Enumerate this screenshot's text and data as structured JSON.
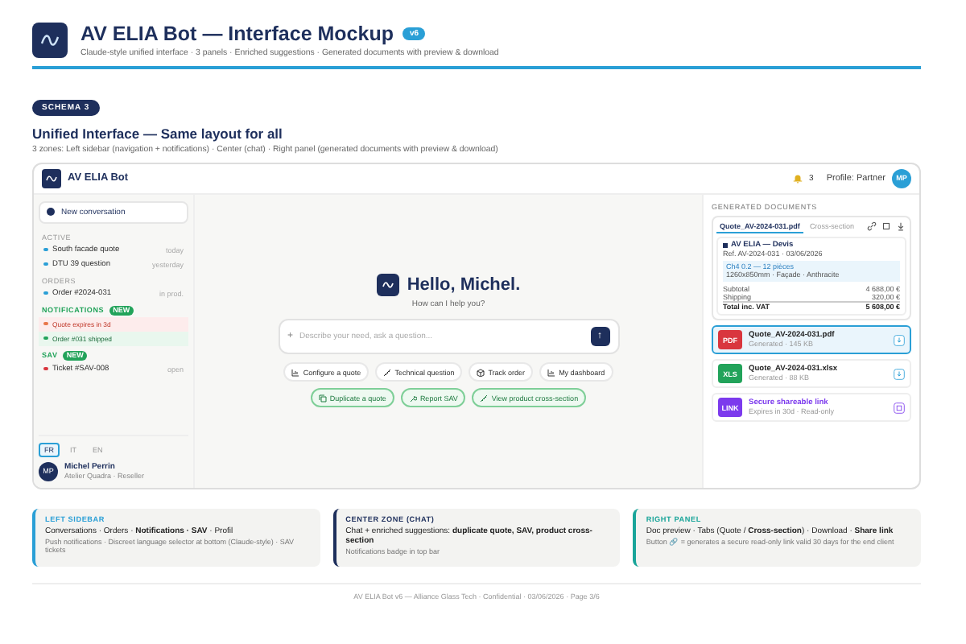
{
  "header": {
    "title": "AV ELIA Bot — Interface Mockup",
    "version": "v6",
    "subtitle": "Claude-style unified interface · 3 panels · Enriched suggestions · Generated documents with preview & download"
  },
  "schema": {
    "badge": "SCHEMA 3",
    "title": "Unified Interface — Same layout for all",
    "subtitle": "3 zones: Left sidebar (navigation + notifications) · Center (chat) · Right panel (generated documents with preview & download)"
  },
  "topbar": {
    "name": "AV ELIA Bot",
    "bell_count": "3",
    "profile": "Profile: Partner",
    "initials": "MP"
  },
  "sidebar": {
    "new_button": "New conversation",
    "sections": [
      {
        "label": "ACTIVE",
        "items": [
          {
            "label": "South facade quote",
            "meta": "today",
            "kind": "normal",
            "color": "#2a9fd6"
          },
          {
            "label": "DTU 39 question",
            "meta": "yesterday",
            "kind": "normal",
            "color": "#2a9fd6"
          }
        ]
      },
      {
        "label": "ORDERS",
        "items": [
          {
            "label": "Order #2024-031",
            "meta": "in prod.",
            "kind": "normal",
            "color": "#2a9fd6"
          }
        ]
      },
      {
        "label": "NOTIFICATIONS",
        "badge": "NEW",
        "items": [
          {
            "label": "Quote expires in 3d",
            "kind": "alert",
            "color": "#e8774a"
          },
          {
            "label": "Order #031 shipped",
            "kind": "success",
            "color": "#22a35a"
          }
        ]
      },
      {
        "label": "SAV",
        "badge": "NEW",
        "items": [
          {
            "label": "Ticket #SAV-008",
            "meta": "open",
            "kind": "normal",
            "color": "#d9363e"
          }
        ]
      }
    ],
    "languages": [
      {
        "label": "FR",
        "selected": true
      },
      {
        "label": "IT",
        "selected": false
      },
      {
        "label": "EN",
        "selected": false
      }
    ],
    "user": {
      "name": "Michel Perrin",
      "role": "Atelier Quadra · Reseller",
      "initials": "MP"
    }
  },
  "chat": {
    "greeting": "Hello, Michel.",
    "prompt": "How can I help you?",
    "placeholder": "Describe your need, ask a question...",
    "plus": "+",
    "send": "↑",
    "suggestions": [
      {
        "label": "Configure a quote",
        "kind": "default"
      },
      {
        "label": "Technical question",
        "kind": "default"
      },
      {
        "label": "Track order",
        "kind": "default"
      },
      {
        "label": "My dashboard",
        "kind": "default"
      },
      {
        "label": "Duplicate a quote",
        "kind": "highlight"
      },
      {
        "label": "Report SAV",
        "kind": "highlight"
      },
      {
        "label": "View product cross-section",
        "kind": "highlight"
      }
    ]
  },
  "panel": {
    "heading": "GENERATED DOCUMENTS",
    "tabs": [
      {
        "label": "Quote_AV-2024-031.pdf",
        "selected": true
      },
      {
        "label": "Cross-section",
        "selected": false
      }
    ],
    "preview": {
      "title": "AV ELIA — Devis",
      "ref": "Ref. AV-2024-031 · 03/06/2026",
      "line": "Ch4 0.2 — 12 pièces",
      "line_sub": "1260x850mm · Façade · Anthracite",
      "rows": [
        {
          "label": "Subtotal",
          "value": "4 688,00 €"
        },
        {
          "label": "Shipping",
          "value": "320,00 €"
        }
      ],
      "total_label": "Total inc. VAT",
      "total": "5 608,00 €"
    },
    "documents": [
      {
        "type": "PDF",
        "name": "Quote_AV-2024-031.pdf",
        "meta": "Generated · 145 KB",
        "selected": true,
        "color": "#d9363e",
        "kind": "download"
      },
      {
        "type": "XLS",
        "name": "Quote_AV-2024-031.xlsx",
        "meta": "Generated · 88 KB",
        "selected": false,
        "color": "#22a35a",
        "kind": "download"
      },
      {
        "type": "LINK",
        "name": "Secure shareable link",
        "meta": "Expires in 30d · Read-only",
        "selected": false,
        "color": "#7c3aed",
        "kind": "link"
      }
    ]
  },
  "notes": [
    {
      "title": "LEFT SIDEBAR",
      "line": "Conversations · Orders · **Notifications · SAV** · Profil",
      "sub": "Push notifications · Discreet language selector at bottom (Claude-style) · SAV tickets",
      "color": "#2a9fd6"
    },
    {
      "title": "CENTER ZONE (CHAT)",
      "line": "Chat + enriched suggestions: **duplicate quote, SAV, product cross-section**",
      "sub": "Notifications badge in top bar",
      "color": "#1e2f5c"
    },
    {
      "title": "RIGHT PANEL",
      "line": "Doc preview · Tabs (Quote / **Cross-section**) · Download · **Share link**",
      "sub": "Button 🔗 = generates a secure read-only link valid 30 days for the end client",
      "color": "#1aa59a"
    }
  ],
  "footer": "AV ELIA Bot v6 — Alliance Glass Tech · Confidential · 03/06/2026 · Page 3/6"
}
